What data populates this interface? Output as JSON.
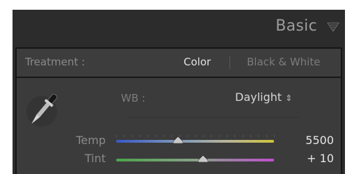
{
  "panel": {
    "title": "Basic",
    "treatment": {
      "label": "Treatment :",
      "options": [
        "Color",
        "Black & White"
      ],
      "selected": "Color"
    },
    "white_balance": {
      "label": "WB :",
      "value": "Daylight",
      "arrows": "⇕"
    },
    "sliders": [
      {
        "label": "Temp",
        "value": "5500",
        "position": 0.39
      },
      {
        "label": "Tint",
        "value": "+ 10",
        "position": 0.55
      }
    ]
  },
  "colors": {
    "panel_bg": "#2c2c2c",
    "content_bg": "#3b3b3b",
    "selected_text": "#e2e2e2",
    "dim_text": "#7c7c7c"
  },
  "icons": {
    "collapse": "collapse-triangle-icon",
    "eyedropper": "eyedropper-icon"
  }
}
